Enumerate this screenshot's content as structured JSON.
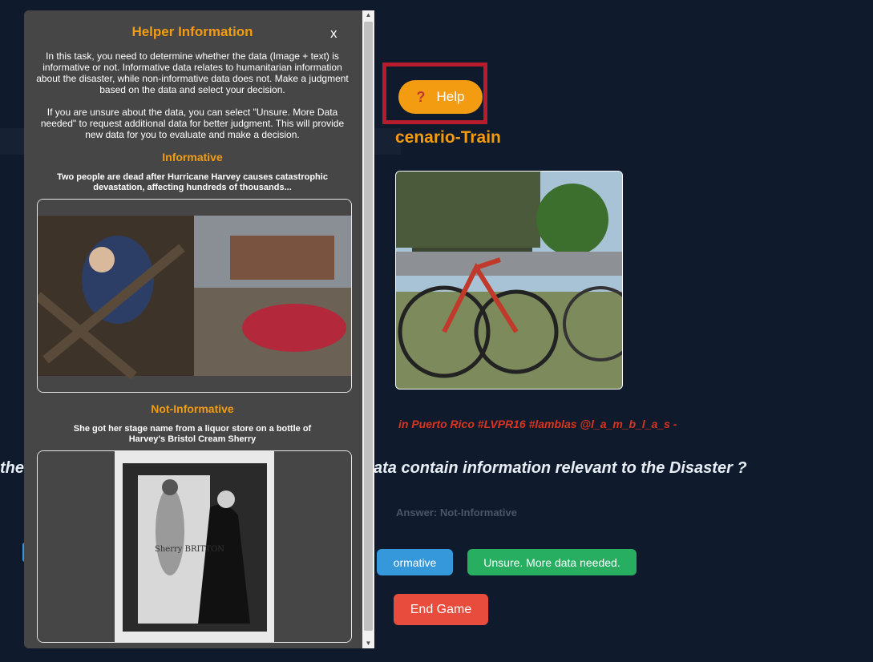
{
  "help": {
    "icon": "question-mark-icon",
    "label": "Help"
  },
  "page": {
    "title": "cenario-Train",
    "tweet": "in Puerto Rico #LVPR16 #lamblas @l_a_m_b_l_a_s -",
    "question_left": "the",
    "question_right": "ata contain information relevant to the Disaster ?",
    "answer": "Answer: Not-Informative"
  },
  "buttons": {
    "informative": "ormative",
    "unsure": "Unsure. More data needed.",
    "end": "End Game"
  },
  "modal": {
    "title": "Helper Information",
    "close": "x",
    "para1": "In this task, you need to determine whether the data (Image + text) is informative or not. Informative data relates to humanitarian information about the disaster, while non-informative data does not. Make a judgment based on the data and select your decision.",
    "para2": "If you are unsure about the data, you can select \"Unsure. More Data needed\" to request additional data for better judgment. This will provide new data for you to evaluate and make a decision.",
    "informative": {
      "heading": "Informative",
      "caption": "Two people are dead after Hurricane Harvey causes catastrophic devastation, affecting hundreds of thousands..."
    },
    "not_informative": {
      "heading": "Not-Informative",
      "caption": "She got her stage name from a liquor store on a bottle of Harvey's Bristol Cream Sherry",
      "sign_text": "Sherry BRITTON"
    }
  },
  "colors": {
    "accent": "#f39c12",
    "highlight": "#b71c2c",
    "tweet": "#d9351f"
  }
}
